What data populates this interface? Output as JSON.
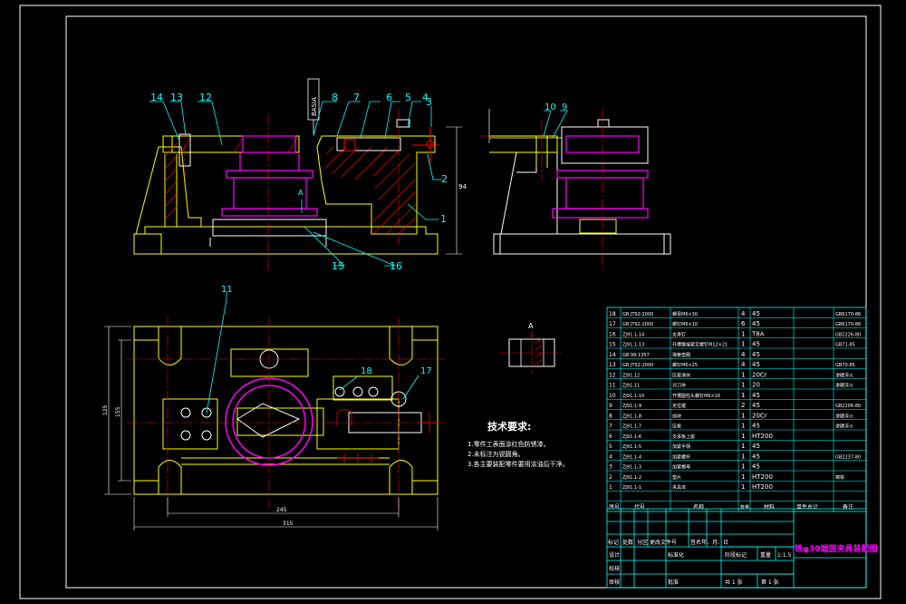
{
  "colors": {
    "background": "#000000",
    "outline": "#ffffff",
    "part": "#ffff00",
    "hatch": "#ff0000",
    "leader": "#00ffff",
    "center": "#ff0000",
    "magenta": "#ff00ff",
    "table": "#00ffff",
    "table_text": "#ffffff"
  },
  "datum_label": "BASIA",
  "section_label": "A",
  "side_dim_label": "94",
  "plan_dims": {
    "width_inner": "245",
    "width_outer": "315",
    "height_left": "155",
    "height_outer": "125"
  },
  "front_view_balloons": [
    "14",
    "13",
    "12",
    "8",
    "7",
    "6",
    "5",
    "4",
    "3",
    "2",
    "1",
    "15",
    "16"
  ],
  "side_view_balloons": [
    "10",
    "9"
  ],
  "plan_view_balloons": [
    "11",
    "18",
    "17"
  ],
  "tech_requirements": {
    "title": "技术要求:",
    "items": [
      "1.零件工表面涂红色防锈漆。",
      "2.未标注为锐圆角。",
      "3.各主要装配零件要用涂油后干净。"
    ]
  },
  "parts_list": {
    "headers": [
      "序号",
      "代号",
      "名称",
      "数量",
      "材料",
      "单件总计",
      "备注"
    ],
    "rows": [
      {
        "no": "18",
        "code": "GB JT92-2000",
        "name": "螺母M6×30",
        "qty": "4",
        "mat": "45",
        "note": "GB6170-86"
      },
      {
        "no": "17",
        "code": "GB JT92-2000",
        "name": "螺钉M6×10",
        "qty": "6",
        "mat": "45",
        "note": "GB6170-86"
      },
      {
        "no": "16",
        "code": "ZJ91.1-14",
        "name": "支承钉",
        "qty": "1",
        "mat": "T8A",
        "note": "GB2226-80"
      },
      {
        "no": "15",
        "code": "ZJ91.1-13",
        "name": "开槽锥端紧定螺钉M12×21",
        "qty": "1",
        "mat": "45",
        "note": "GB71-85"
      },
      {
        "no": "14",
        "code": "GB 99-1357",
        "name": "弹簧垫圈",
        "qty": "4",
        "mat": "45",
        "note": ""
      },
      {
        "no": "13",
        "code": "GB JT92-2000",
        "name": "螺钉M6×25",
        "qty": "4",
        "mat": "45",
        "note": "GB70-85"
      },
      {
        "no": "12",
        "code": "ZJ91.12",
        "name": "压紧滑块",
        "qty": "1",
        "mat": "20Cr",
        "note": "渗碳淬火"
      },
      {
        "no": "11",
        "code": "ZJ91.11",
        "name": "对刀块",
        "qty": "1",
        "mat": "20",
        "note": "渗碳淬火"
      },
      {
        "no": "10",
        "code": "ZJ91.1-10",
        "name": "开槽圆柱头螺钉M6×16",
        "qty": "1",
        "mat": "45",
        "note": ""
      },
      {
        "no": "9",
        "code": "ZJ91.1-9",
        "name": "定位键",
        "qty": "2",
        "mat": "45",
        "note": "GB2206-80"
      },
      {
        "no": "8",
        "code": "ZJ91.1-8",
        "name": "挡块",
        "qty": "1",
        "mat": "20Cr",
        "note": "渗碳淬火"
      },
      {
        "no": "7",
        "code": "ZJ91.1-7",
        "name": "压板",
        "qty": "1",
        "mat": "45",
        "note": "渗碳淬火"
      },
      {
        "no": "6",
        "code": "ZJ91.1-6",
        "name": "支承板上座",
        "qty": "1",
        "mat": "HT200",
        "note": ""
      },
      {
        "no": "5",
        "code": "ZJ91.1-5",
        "name": "加紧手柄",
        "qty": "1",
        "mat": "45",
        "note": ""
      },
      {
        "no": "4",
        "code": "ZJ91.1-4",
        "name": "加紧螺杆",
        "qty": "1",
        "mat": "45",
        "note": "GB2237-80"
      },
      {
        "no": "3",
        "code": "ZJ91.1-3",
        "name": "加紧螺母",
        "qty": "1",
        "mat": "45",
        "note": ""
      },
      {
        "no": "2",
        "code": "ZJ91.1-2",
        "name": "垫片",
        "qty": "1",
        "mat": "HT200",
        "note": "铸铁"
      },
      {
        "no": "1",
        "code": "ZJ91.1-1",
        "name": "夹具体",
        "qty": "1",
        "mat": "HT200",
        "note": ""
      }
    ]
  },
  "title_block": {
    "drawing_title": "铣φ30端面夹具装配图",
    "row_labels": [
      "标记",
      "处数",
      "分区",
      "更改文件号",
      "签名",
      "年、月、日"
    ],
    "left_labels": [
      "设计",
      "校核",
      "审核",
      "工艺"
    ],
    "std_label": "标准化",
    "approve_label": "批准",
    "stage_label": "阶段标记",
    "weight_label": "重量",
    "scale_label": "比例",
    "scale": "1:1.5",
    "sheets": "共 1 张",
    "sheet_no": "第 1 张"
  }
}
